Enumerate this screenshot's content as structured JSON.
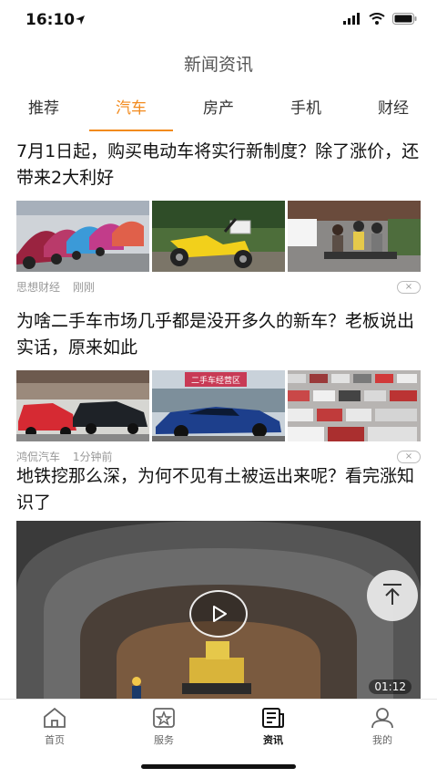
{
  "status_bar": {
    "time": "16:10"
  },
  "nav": {
    "title": "新闻资讯"
  },
  "tabs": [
    {
      "label": "推荐",
      "active": false
    },
    {
      "label": "汽车",
      "active": true
    },
    {
      "label": "房产",
      "active": false
    },
    {
      "label": "手机",
      "active": false
    },
    {
      "label": "财经",
      "active": false
    }
  ],
  "articles": [
    {
      "title": "7月1日起，购买电动车将实行新制度？除了涨价，还带来2大利好",
      "source": "思想财经",
      "time": "刚刚",
      "close_label": "×",
      "images": [
        "electric-scooters-row",
        "yellow-electric-scooter",
        "riders-on-street"
      ]
    },
    {
      "title": "为啥二手车市场几乎都是没开多久的新车？老板说出实话，原来如此",
      "source": "鸿侃汽车",
      "time": "1分钟前",
      "close_label": "×",
      "images": [
        "used-cars-lot",
        "blue-sports-car",
        "parking-lot-cars"
      ],
      "image_sign_text": "二手车经营区"
    },
    {
      "title": "地铁挖那么深，为何不见有土被运出来呢？看完涨知识了",
      "video_duration": "01:12"
    }
  ],
  "tabbar": [
    {
      "label": "首页",
      "icon": "home-icon",
      "active": false
    },
    {
      "label": "服务",
      "icon": "service-star-icon",
      "active": false
    },
    {
      "label": "资讯",
      "icon": "news-icon",
      "active": true
    },
    {
      "label": "我的",
      "icon": "user-icon",
      "active": false
    }
  ],
  "colors": {
    "accent": "#f28a1d"
  }
}
